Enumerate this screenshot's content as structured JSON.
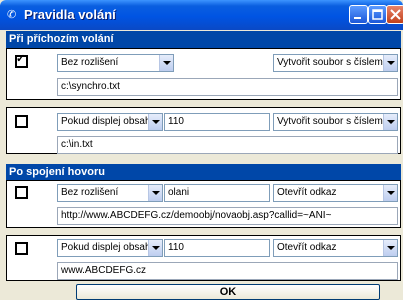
{
  "window": {
    "title": "Pravidla volání"
  },
  "sections": [
    {
      "heading": "Při příchozím volání"
    },
    {
      "heading": "Po spojení hovoru"
    }
  ],
  "rules": [
    {
      "checked": true,
      "condition": "Bez rozlišení",
      "value": "",
      "action": "Vytvořit soubor s číslem vol",
      "target": "c:\\synchro.txt"
    },
    {
      "checked": false,
      "condition": "Pokud displej obsahuje",
      "value": "110",
      "action": "Vytvořit soubor s číslem vol",
      "target": "c:\\in.txt"
    },
    {
      "checked": false,
      "condition": "Bez rozlišení",
      "value": "olani",
      "action": "Otevřít odkaz",
      "target": "http://www.ABCDEFG.cz/demoobj/novaobj.asp?callid=~ANI~"
    },
    {
      "checked": false,
      "condition": "Pokud displej obsahuje",
      "value": "110",
      "action": "Otevřít odkaz",
      "target": "www.ABCDEFG.cz"
    }
  ],
  "buttons": {
    "ok_label": "OK"
  },
  "colors": {
    "titlebar": "#0054e3",
    "section_bar": "#0047a8",
    "dialog_bg": "#ece9d8"
  },
  "icons": {
    "window": "phone-rules-icon",
    "minimize": "minimize-icon",
    "maximize": "maximize-icon",
    "close": "close-icon"
  }
}
